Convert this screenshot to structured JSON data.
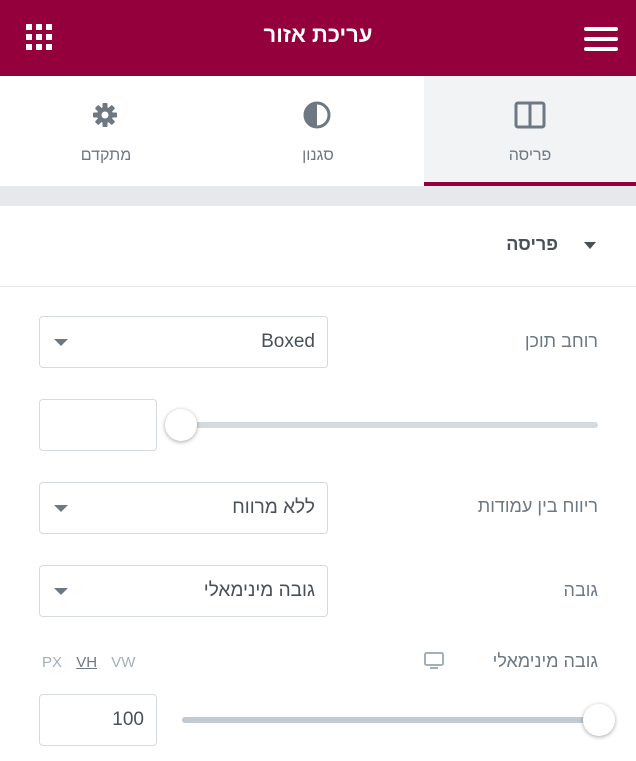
{
  "header": {
    "title": "עריכת אזור"
  },
  "tabs": [
    {
      "label": "פריסה",
      "icon": "columns-icon",
      "active": true
    },
    {
      "label": "סגנון",
      "icon": "contrast-icon",
      "active": false
    },
    {
      "label": "מתקדם",
      "icon": "gear-icon",
      "active": false
    }
  ],
  "section": {
    "title": "פריסה"
  },
  "controls": {
    "content_width": {
      "label": "רוחב תוכן",
      "value": "Boxed"
    },
    "width_slider": {
      "value": "",
      "position_fraction": 0.0
    },
    "column_gap": {
      "label": "ריווח בין עמודות",
      "value": "ללא מרווח"
    },
    "height": {
      "label": "גובה",
      "value": "גובה מינימאלי"
    },
    "min_height": {
      "label": "גובה מינימאלי",
      "units": [
        "PX",
        "VH",
        "VW"
      ],
      "selected_unit": "VH",
      "value": "100",
      "position_fraction": 1.0
    }
  },
  "colors": {
    "brand": "#93003c",
    "tab_active_bg": "#f1f3f5",
    "separator": "#e6e9ec"
  }
}
